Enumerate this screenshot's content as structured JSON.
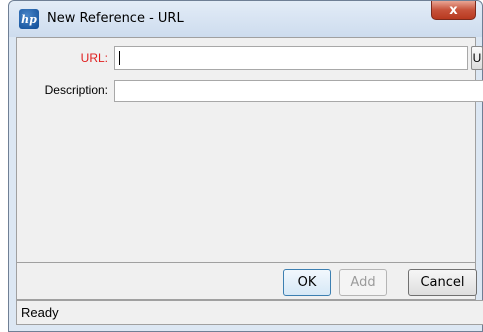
{
  "window": {
    "title": "New Reference - URL",
    "app_icon_text": "hp",
    "close_label": "x"
  },
  "form": {
    "url_label": "URL:",
    "url_value": "",
    "url_lookup_button": "U",
    "description_label": "Description:",
    "description_value": ""
  },
  "buttons": {
    "ok": "OK",
    "add": "Add",
    "cancel": "Cancel"
  },
  "status": {
    "text": "Ready"
  },
  "colors": {
    "required_label": "#e01f1f",
    "disabled_text": "#9b9b9b",
    "close_button": "#c7523a"
  },
  "icons": {
    "app": "hp-logo-icon",
    "close": "close-icon"
  }
}
